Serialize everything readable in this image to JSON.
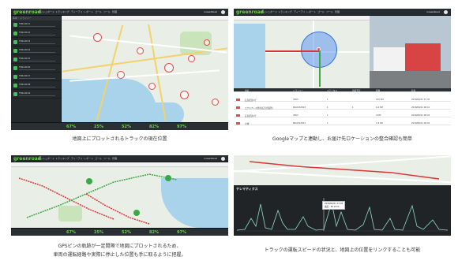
{
  "app": {
    "logo": "greenroad",
    "nav": [
      "ダッシュボード",
      "トラッキング",
      "ディーアイ",
      "レポート",
      "ゴール",
      "ツール",
      "管理"
    ],
    "user": "GreenRoad"
  },
  "panels": {
    "p1": {
      "sidebar_header": "車両・ドライバー",
      "vehicles": [
        "TRK-0011",
        "TRK-0012",
        "TRK-0013",
        "TRK-0014",
        "TRK-0015",
        "TRK-0016",
        "TRK-0017",
        "TRK-0018",
        "TRK-0019"
      ],
      "status_values": [
        "67%",
        "25%",
        "52%",
        "82%",
        "97%"
      ],
      "caption": "地図上にプロットされるトラックの現在位置"
    },
    "p2": {
      "table_headers": [
        "",
        "車両",
        "ドライバー",
        "ステータス",
        "到着予定",
        "距離",
        "時刻"
      ],
      "table_rows": [
        [
          "",
          "広島配送1号",
          "7063",
          "1",
          "",
          "270 KM",
          "2018/06/21 07:35"
        ],
        [
          "",
          "エクスプレス便(新広島営業所)",
          "RR-0032503",
          "1",
          "1",
          "0.4 KM",
          "2018/06/21 08:10"
        ],
        [
          "",
          "広島配送2号",
          "7063",
          "1",
          "",
          "4 KM",
          "2018/06/21 08:24"
        ],
        [
          "",
          "全体",
          "BR-0012503",
          "1",
          "",
          "1.8 KM",
          "2018/06/21 09:02"
        ]
      ],
      "caption": "Googleマップと連動し、お届け先ロケーションの整合確認も簡単"
    },
    "p3": {
      "status_values": [
        "67%",
        "25%",
        "52%",
        "82%",
        "97%"
      ],
      "caption_line1": "GPSピンの軌跡が一定間隔で地図にプロットされるため、",
      "caption_line2": "車両の運転経路や実際に停止した位置も手に取るように把握。"
    },
    "p4": {
      "chart_title": "テレマティクス",
      "tooltip_line1": "2018/06/21 13:05",
      "tooltip_line2": "速度 : 46 km/h",
      "caption": "トラックの運転スピードの状況と、地図上の位置をリンクすることも可能"
    }
  },
  "colors": {
    "brand_green": "#6bd24a",
    "marker_red": "#e34b4b",
    "track_red": "#d93636",
    "track_green": "#3aa845",
    "speed_line": "#8fd9c8"
  }
}
